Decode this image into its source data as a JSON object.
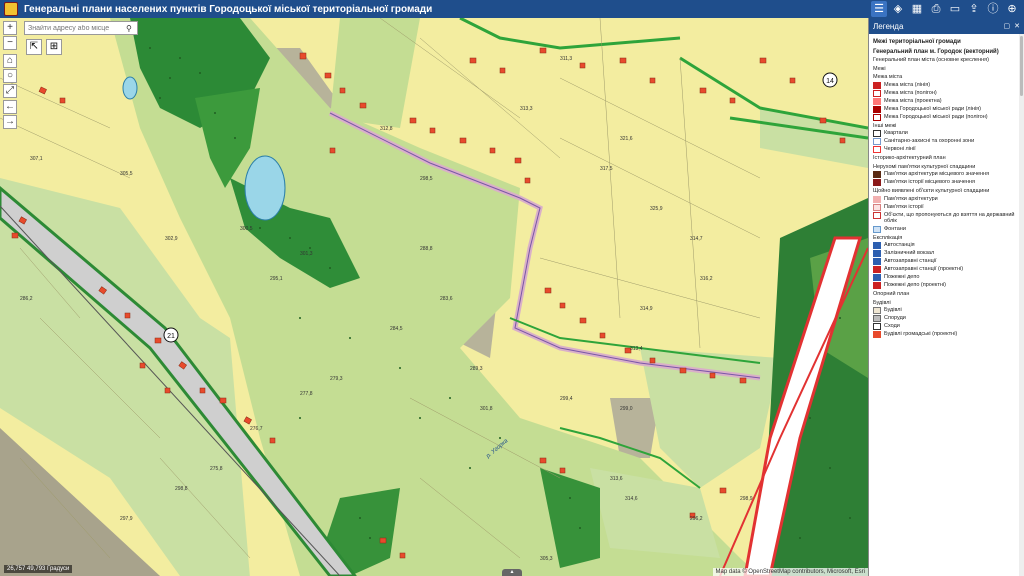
{
  "app": {
    "title": "Генеральні плани населених пунктів Городоцької міської територіальної громади"
  },
  "toolbar": {
    "icons": [
      "legend-list-icon",
      "layers-icon",
      "basemap-icon",
      "print-icon",
      "measure-icon",
      "share-icon",
      "info-icon",
      "globe-icon"
    ]
  },
  "search": {
    "placeholder": "Знайти адресу або місце"
  },
  "map": {
    "coordinates": "26,757 49,793 Градуси",
    "attribution": "Map data © OpenStreetMap contributors, Microsoft, Esri",
    "road_badge": "21",
    "parcel_badge": "14",
    "labels": [
      "311,3",
      "313,3",
      "321,6",
      "317,5",
      "325,9",
      "314,7",
      "316,2",
      "314,9",
      "313,4",
      "307,1",
      "305,5",
      "302,9",
      "300,5",
      "301,3",
      "295,1",
      "288,8",
      "283,6",
      "284,5",
      "279,3",
      "277,8",
      "276,7",
      "275,8",
      "298,8",
      "297,9",
      "312,8",
      "298,5",
      "313,6",
      "314,6",
      "296,2",
      "299,0",
      "305,3",
      "289,3",
      "301,8",
      "299,4",
      "298,9",
      "286,2"
    ],
    "river_label": "р. Угорка"
  },
  "legend": {
    "title": "Легенда",
    "sections": [
      {
        "label": "Межі територіальної громади",
        "kind": "h"
      },
      {
        "label": "Генеральний план м. Городок (векторний)",
        "kind": "h"
      },
      {
        "label": "Генеральний план міста (основне креслення)",
        "kind": "t"
      },
      {
        "label": "Межі",
        "kind": "t"
      },
      {
        "label": "Межа міста",
        "kind": "t"
      },
      {
        "label": "Межа міста (лінія)",
        "kind": "i",
        "color": "#cc2222"
      },
      {
        "label": "Межа міста (полігон)",
        "kind": "i",
        "color": "#ffffff",
        "border": "#cc2222"
      },
      {
        "label": "Межа міста (проектна)",
        "kind": "i",
        "color": "#ff7777"
      },
      {
        "label": "Межа Городоцької міської ради (лінія)",
        "kind": "i",
        "color": "#aa0000"
      },
      {
        "label": "Межа Городоцької міської ради (полігон)",
        "kind": "i",
        "color": "#ffffff",
        "border": "#aa0000"
      },
      {
        "label": "Інші межі",
        "kind": "t"
      },
      {
        "label": "Квартали",
        "kind": "i",
        "color": "#ffffff",
        "border": "#333333"
      },
      {
        "label": "Санітарно-захисні та охоронні зони",
        "kind": "i",
        "color": "#ffffff",
        "border": "#7799cc"
      },
      {
        "label": "Червоні лінії",
        "kind": "i",
        "color": "#ffffff",
        "border": "#ee3333"
      },
      {
        "label": "Історико-архітектурний план",
        "kind": "t"
      },
      {
        "label": "Нерухомі пам'ятки культурної спадщини",
        "kind": "t"
      },
      {
        "label": "Пам'ятки архітектури місцевого значення",
        "kind": "i",
        "color": "#5a2a12"
      },
      {
        "label": "Пам'ятки історії місцевого значення",
        "kind": "i",
        "color": "#8b1a1a"
      },
      {
        "label": "Щойно виявлені об'єкти культурної спадщини",
        "kind": "t"
      },
      {
        "label": "Пам'ятки архітектури",
        "kind": "i",
        "color": "#f2b0b0"
      },
      {
        "label": "Пам'ятки історії",
        "kind": "i",
        "color": "#fbe3e3",
        "border": "#d78080"
      },
      {
        "label": "Об'єкти, що пропонуються до взяття на державний облік",
        "kind": "i",
        "color": "#ffffff",
        "border": "#cc3333"
      },
      {
        "label": "Фонтани",
        "kind": "i",
        "color": "#cfe2f5",
        "border": "#6699cc"
      },
      {
        "label": "Експлікація",
        "kind": "t"
      },
      {
        "label": "Автостанція",
        "kind": "i",
        "color": "#2d5fb0"
      },
      {
        "label": "Залізничний вокзал",
        "kind": "i",
        "color": "#2d5fb0"
      },
      {
        "label": "Автозаправні станції",
        "kind": "i",
        "color": "#2d5fb0"
      },
      {
        "label": "Автозаправні станції (проектні)",
        "kind": "i",
        "color": "#cc2222"
      },
      {
        "label": "Пожежні депо",
        "kind": "i",
        "color": "#2d5fb0"
      },
      {
        "label": "Пожежні депо (проектні)",
        "kind": "i",
        "color": "#cc2222"
      },
      {
        "label": "Опорний план",
        "kind": "t"
      },
      {
        "label": "Будівлі",
        "kind": "t"
      },
      {
        "label": "Будівлі",
        "kind": "i",
        "color": "#efe6d2",
        "border": "#777777"
      },
      {
        "label": "Споруди",
        "kind": "i",
        "color": "#bdbdbd",
        "border": "#666666"
      },
      {
        "label": "Сходи",
        "kind": "i",
        "color": "#ffffff",
        "border": "#333333"
      },
      {
        "label": "Будівлі громадські (проектні)",
        "kind": "i",
        "color": "#e84a2c"
      }
    ]
  }
}
